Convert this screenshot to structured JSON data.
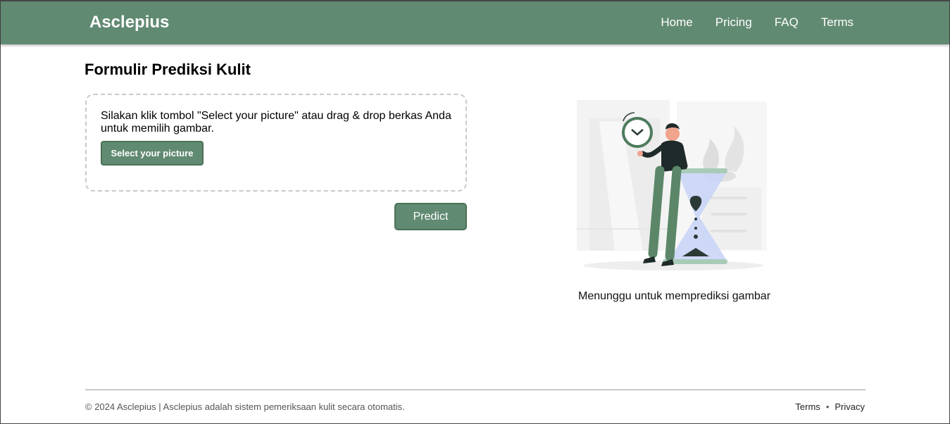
{
  "navbar": {
    "brand": "Asclepius",
    "links": [
      "Home",
      "Pricing",
      "FAQ",
      "Terms"
    ]
  },
  "main": {
    "title": "Formulir Prediksi Kulit",
    "dropzone_text": "Silakan klik tombol \"Select your picture\" atau drag & drop berkas Anda untuk memilih gambar.",
    "select_button": "Select your picture",
    "predict_button": "Predict",
    "waiting_text": "Menunggu untuk memprediksi gambar"
  },
  "footer": {
    "copyright": "© 2024 Asclepius | Asclepius adalah sistem pemeriksaan kulit secara otomatis.",
    "links": [
      "Terms",
      "Privacy"
    ],
    "separator": "•"
  },
  "colors": {
    "primary": "#618a72",
    "primary_border": "#4c7059"
  },
  "icons": {
    "illustration": "waiting-hourglass-illustration"
  }
}
